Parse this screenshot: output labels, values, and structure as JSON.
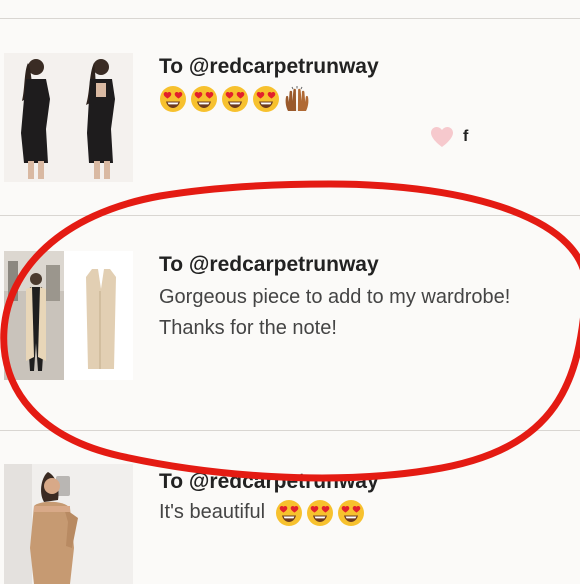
{
  "colors": {
    "background": "#fbfaf8",
    "divider": "#d9d6d2",
    "highlight": "#e41b13",
    "heart": "#f6c9cd"
  },
  "comments": [
    {
      "to": "To @redcarpetrunway",
      "emojis": [
        "heart-eyes-emoji",
        "heart-eyes-emoji",
        "heart-eyes-emoji",
        "heart-eyes-emoji",
        "raised-hands-emoji"
      ],
      "like_label": "f",
      "thumbnail": "black-lace-dress-photo"
    },
    {
      "to": "To @redcarpetrunway",
      "lines": [
        "Gorgeous piece to add to my wardrobe!",
        "Thanks for the note!"
      ],
      "thumbnail": "beige-long-vest-photo"
    },
    {
      "to": "To @redcarpetrunway",
      "text": "It's beautiful",
      "emojis": [
        "heart-eyes-emoji",
        "heart-eyes-emoji",
        "heart-eyes-emoji"
      ],
      "thumbnail": "sequin-dress-photo"
    }
  ]
}
